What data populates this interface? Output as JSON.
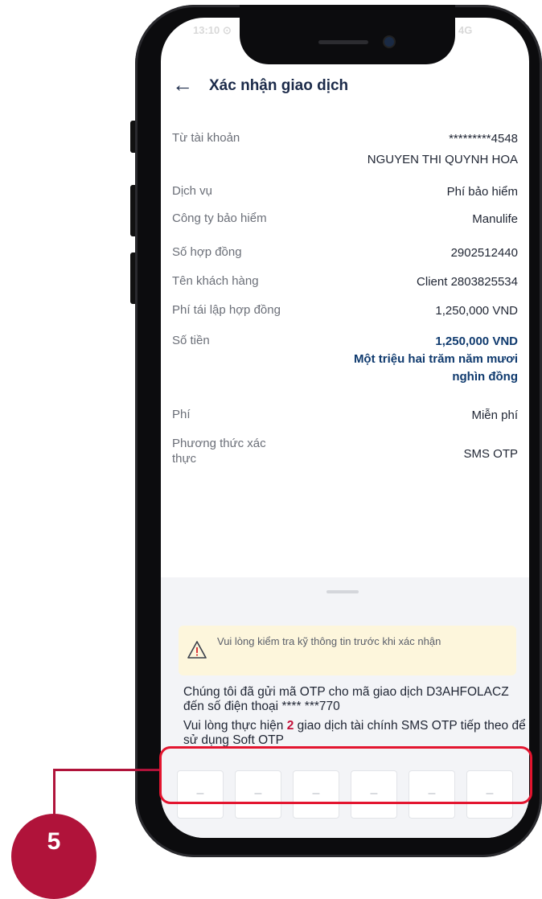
{
  "status_bar": {
    "time": "13:10 ⊙",
    "network": "4G"
  },
  "header": {
    "title": "Xác nhận giao dịch"
  },
  "details": [
    {
      "label": "Từ tài khoản",
      "value": "*********4548",
      "value2": "NGUYEN THI QUYNH HOA"
    },
    {
      "label": "Dịch vụ",
      "value": "Phí bảo hiểm"
    },
    {
      "label": "Công ty bảo hiểm",
      "value": "Manulife"
    },
    {
      "label": "Số hợp đồng",
      "value": "2902512440"
    },
    {
      "label": "Tên khách hàng",
      "value": "Client 2803825534"
    },
    {
      "label": "Phí tái lập hợp đồng",
      "value": "1,250,000 VND"
    },
    {
      "label": "Số tiền",
      "value": "1,250,000 VND",
      "value2": "Một triệu hai trăm năm mươi nghìn đồng"
    },
    {
      "label": "Phí",
      "value": "Miễn phí"
    },
    {
      "label": "Phương thức xác thực",
      "value": "SMS OTP"
    }
  ],
  "sheet": {
    "warning": "Vui lòng kiểm tra kỹ thông tin trước khi xác nhận",
    "otp_message": "Chúng tôi đã gửi mã OTP cho mã giao dịch D3AHFOLACZ đến số điện thoại **** ***770",
    "note_before": "Vui lòng thực hiện ",
    "note_count": "2",
    "note_after": " giao dịch tài chính SMS OTP tiếp theo để sử dụng Soft OTP",
    "otp_placeholders": [
      "–",
      "–",
      "–",
      "–",
      "–",
      "–"
    ]
  },
  "annotation": {
    "step": "5",
    "color": "#b0133a",
    "highlight_color": "#e3152f"
  }
}
